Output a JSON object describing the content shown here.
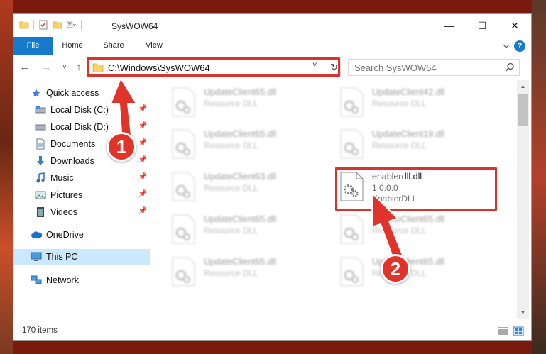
{
  "window": {
    "title": "SysWOW64",
    "controls": {
      "minimize": "—",
      "maximize": "☐",
      "close": "✕"
    }
  },
  "ribbon": {
    "tabs": [
      "File",
      "Home",
      "Share",
      "View"
    ],
    "help": "?"
  },
  "nav": {
    "back": "←",
    "forward": "→",
    "recent": "˅",
    "up": "↑",
    "address": "C:\\Windows\\SysWOW64",
    "address_dropdown": "˅",
    "refresh": "↻",
    "search_placeholder": "Search SysWOW64"
  },
  "sidebar": {
    "items": [
      {
        "label": "Quick access",
        "icon": "star-icon",
        "pinned": false
      },
      {
        "label": "Local Disk (C:)",
        "icon": "drive-icon",
        "pinned": true
      },
      {
        "label": "Local Disk (D:)",
        "icon": "drive-icon",
        "pinned": true
      },
      {
        "label": "Documents",
        "icon": "documents-icon",
        "pinned": true
      },
      {
        "label": "Downloads",
        "icon": "download-icon",
        "pinned": true
      },
      {
        "label": "Music",
        "icon": "music-icon",
        "pinned": true
      },
      {
        "label": "Pictures",
        "icon": "pictures-icon",
        "pinned": true
      },
      {
        "label": "Videos",
        "icon": "videos-icon",
        "pinned": true
      },
      {
        "label": "OneDrive",
        "icon": "cloud-icon",
        "pinned": false
      },
      {
        "label": "This PC",
        "icon": "computer-icon",
        "pinned": false,
        "selected": true
      },
      {
        "label": "Network",
        "icon": "network-icon",
        "pinned": false
      }
    ]
  },
  "files": {
    "left": [
      {
        "name": "UpdateClient65.dll",
        "type": "Resource DLL"
      },
      {
        "name": "UpdateClient65.dll",
        "type": "Resource DLL"
      },
      {
        "name": "UpdateClient63.dll",
        "type": "Resource DLL"
      },
      {
        "name": "UpdateClient65.dll",
        "type": "Resource DLL"
      },
      {
        "name": "UpdateClient65.dll",
        "type": "Resource DLL"
      }
    ],
    "right": [
      {
        "name": "UpdateClient42.dll",
        "type": "Resource DLL"
      },
      {
        "name": "UpdateClient19.dll",
        "type": "Resource DLL"
      },
      {
        "name": "enablerdll.dll",
        "version": "1.0.0.0",
        "type": "EnablerDLL",
        "highlighted": true
      },
      {
        "name": "UpdateClient65.dll",
        "type": "Resource DLL"
      },
      {
        "name": "UpdateClient65.dll",
        "type": "Resource DLL"
      }
    ]
  },
  "status": {
    "item_count": "170 items"
  },
  "annotations": {
    "step1": "1",
    "step2": "2",
    "color": "#d9342b"
  }
}
